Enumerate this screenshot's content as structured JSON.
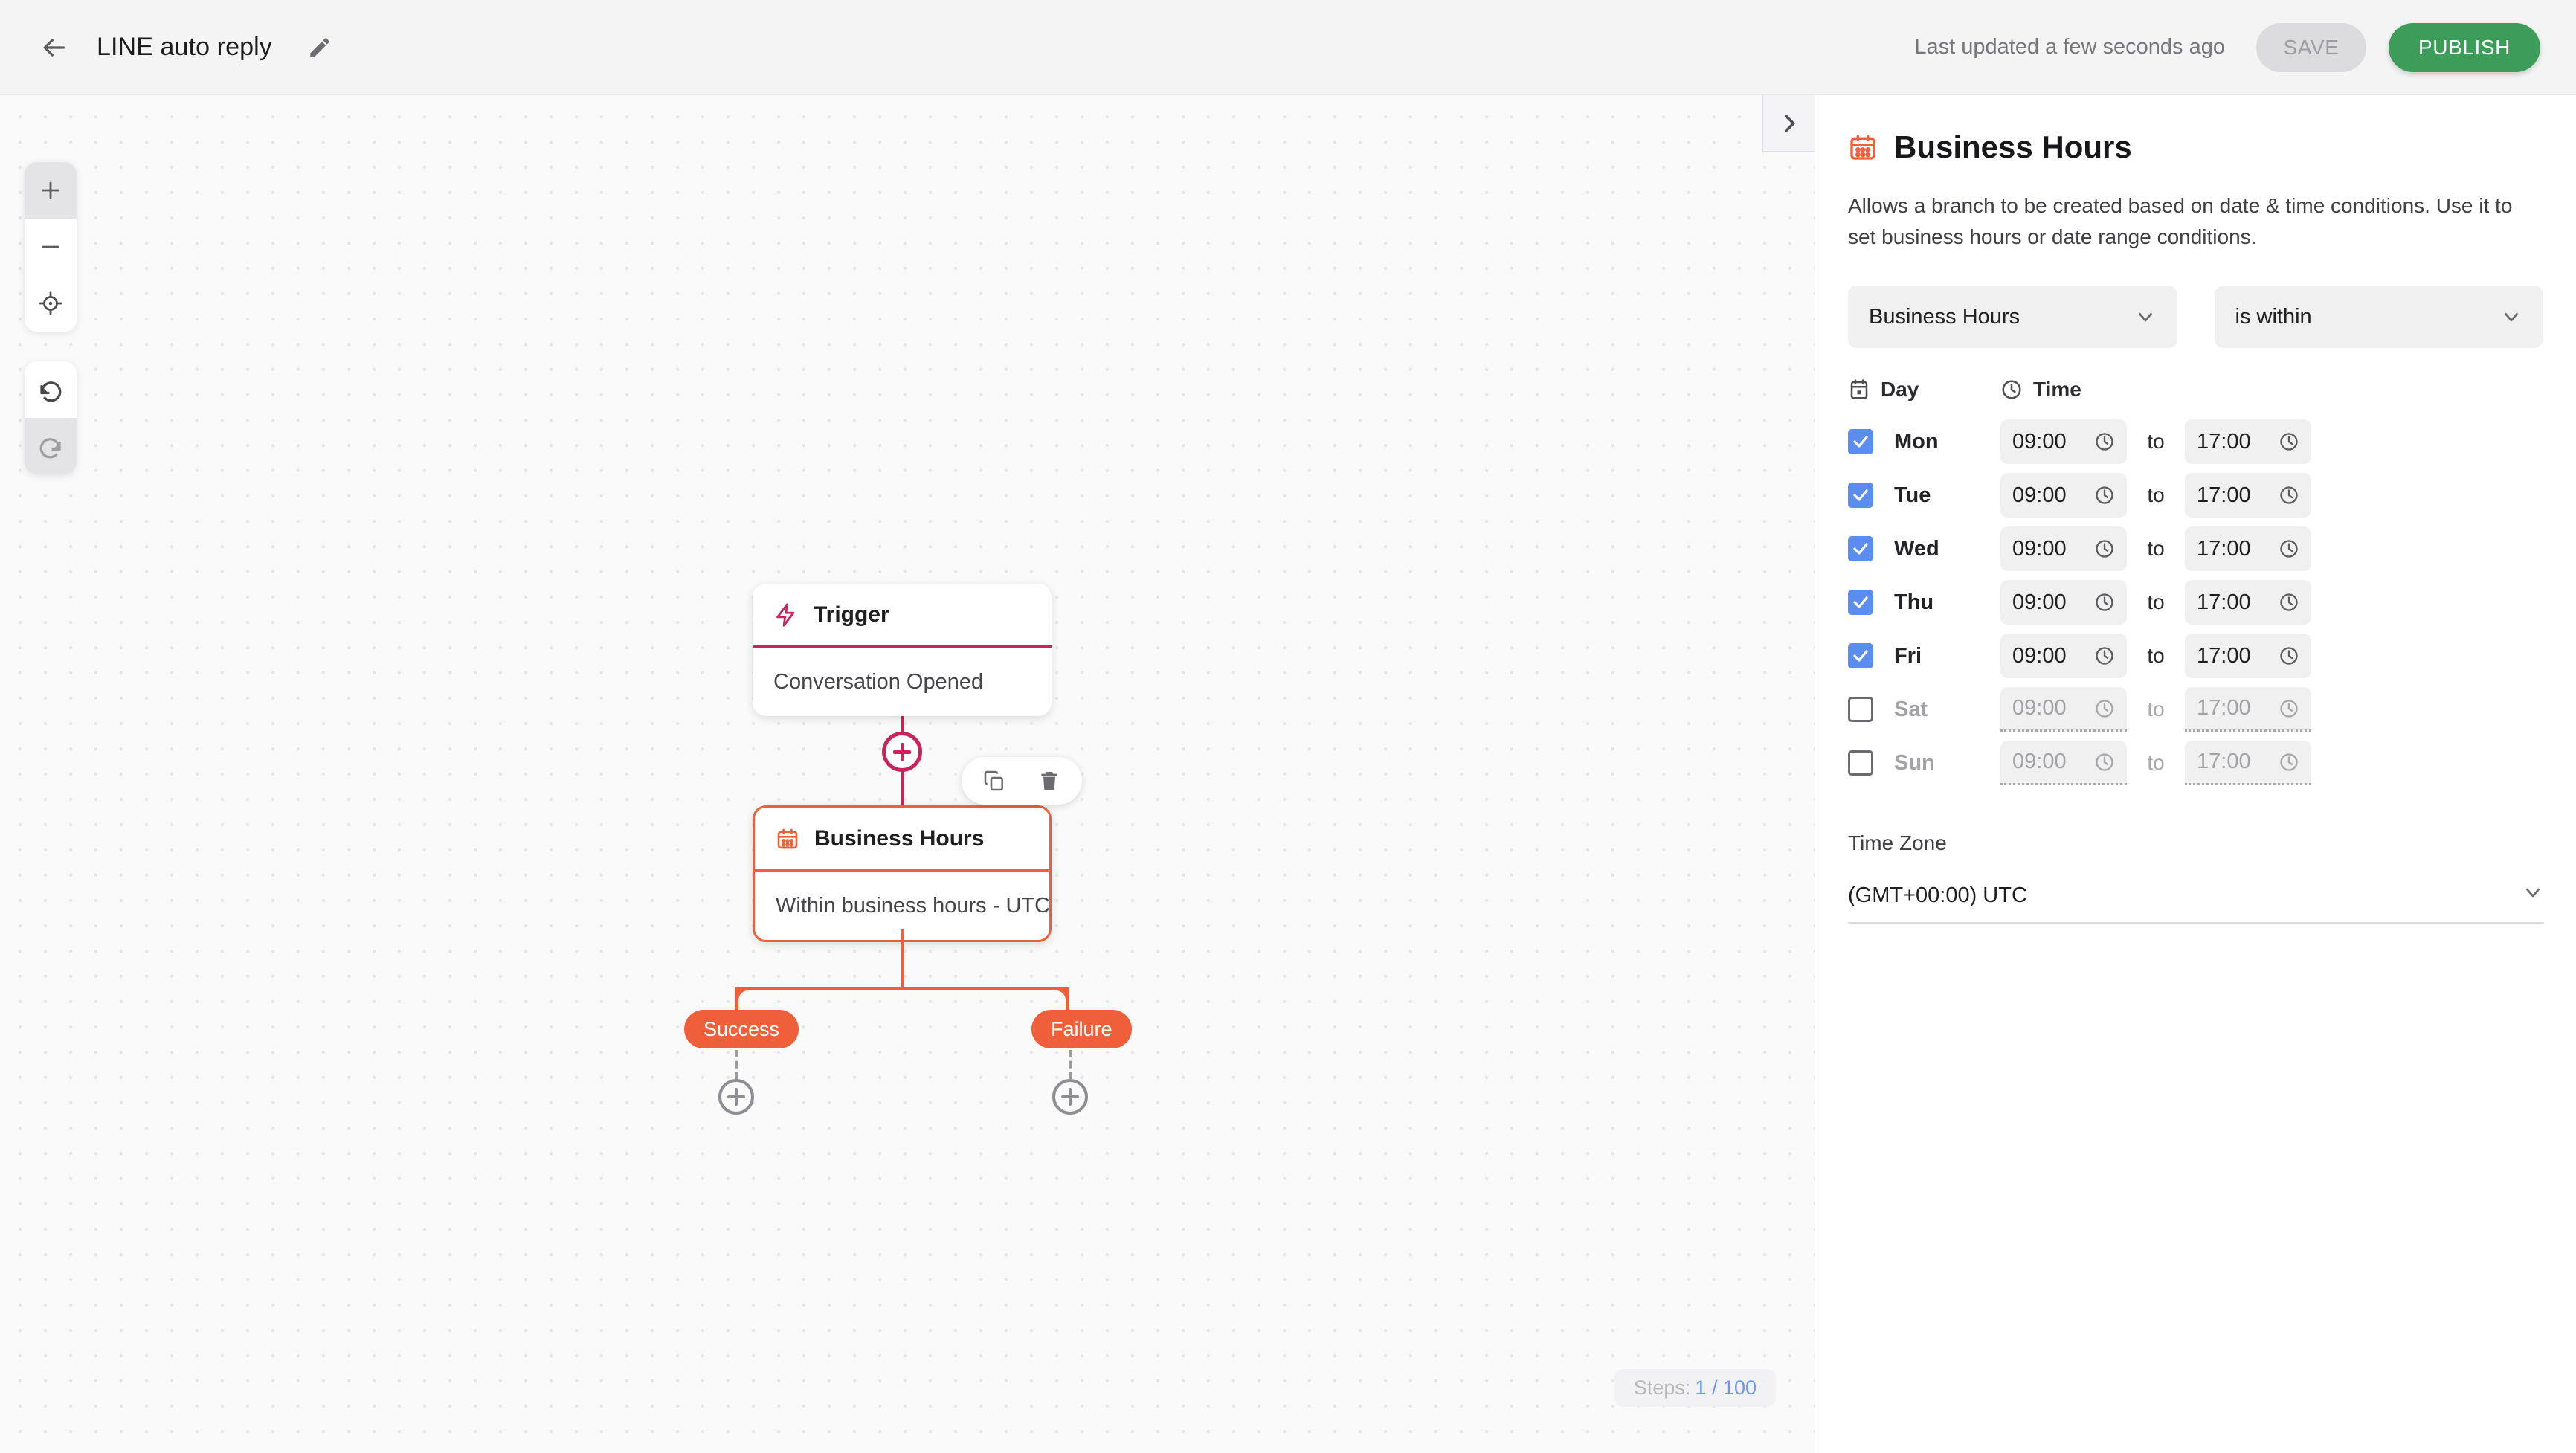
{
  "topbar": {
    "back_icon": "arrow-left-icon",
    "title": "LINE auto reply",
    "edit_icon": "pencil-icon",
    "last_updated": "Last updated a few seconds ago",
    "save_label": "SAVE",
    "publish_label": "PUBLISH",
    "publish_color": "#3c9d58",
    "save_bg_color": "#dcdcdf"
  },
  "canvas": {
    "zoom_in_icon": "plus-icon",
    "zoom_out_icon": "minus-icon",
    "fit_view_icon": "crosshair-icon",
    "undo_icon": "undo-arrow-icon",
    "redo_icon": "redo-arrow-icon",
    "panel_toggle_icon": "chevron-right-icon",
    "steps_label": "Steps:",
    "steps_value": "1 / 100",
    "steps_value_color": "#6e94f2"
  },
  "flow": {
    "trigger_node": {
      "icon": "lightning-bolt-icon",
      "title": "Trigger",
      "body": "Conversation Opened",
      "accent_color": "#c8255c"
    },
    "business_hours_node": {
      "icon": "calendar-icon",
      "title": "Business Hours",
      "body": "Within business hours - UTC",
      "accent_color": "#ef603a",
      "selected": true
    },
    "node_toolbar": {
      "duplicate_icon": "copy-icon",
      "delete_icon": "trash-icon"
    },
    "add_inline_icon": "plus-circle-icon",
    "branches": [
      {
        "label": "Success",
        "add_icon": "plus-circle-icon"
      },
      {
        "label": "Failure",
        "add_icon": "plus-circle-icon"
      }
    ]
  },
  "panel": {
    "icon": "calendar-icon",
    "title": "Business Hours",
    "description": "Allows a branch to be created based on date & time conditions. Use it to set business hours or date range conditions.",
    "condition_type": "Business Hours",
    "condition_operator": "is within",
    "chevron_icon": "chevron-down-icon",
    "columns": {
      "day_icon": "calendar-icon",
      "day_label": "Day",
      "time_icon": "clock-icon",
      "time_label": "Time"
    },
    "to_word": "to",
    "clock_icon": "clock-icon",
    "checkbox_on_color": "#5b8cf0",
    "days": [
      {
        "name": "Mon",
        "checked": true,
        "from": "09:00",
        "to": "17:00"
      },
      {
        "name": "Tue",
        "checked": true,
        "from": "09:00",
        "to": "17:00"
      },
      {
        "name": "Wed",
        "checked": true,
        "from": "09:00",
        "to": "17:00"
      },
      {
        "name": "Thu",
        "checked": true,
        "from": "09:00",
        "to": "17:00"
      },
      {
        "name": "Fri",
        "checked": true,
        "from": "09:00",
        "to": "17:00"
      },
      {
        "name": "Sat",
        "checked": false,
        "from": "09:00",
        "to": "17:00"
      },
      {
        "name": "Sun",
        "checked": false,
        "from": "09:00",
        "to": "17:00"
      }
    ],
    "timezone_label": "Time Zone",
    "timezone_value": "(GMT+00:00) UTC"
  }
}
